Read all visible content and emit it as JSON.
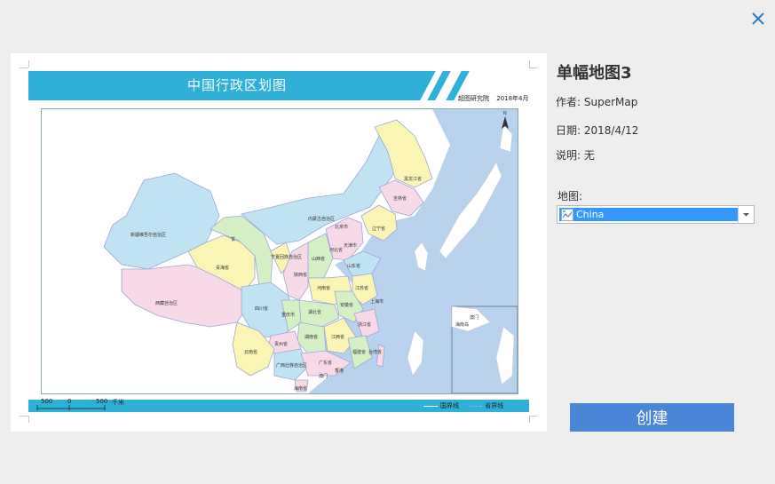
{
  "dialog": {
    "close_icon": "close-icon",
    "accent_color": "#2d7cc7"
  },
  "preview": {
    "banner_title": "中国行政区划图",
    "publisher": "超图研究院",
    "date": "2018年4月",
    "scale": {
      "left": "500",
      "zero": "0",
      "right": "500",
      "unit": "千米"
    },
    "legend": {
      "national_border": "国界线",
      "provincial_border": "省界线"
    },
    "colors": {
      "banner": "#2eb0d8",
      "sea": "#b8d2ee",
      "yellow": "#fbf5b5",
      "pink": "#f8d9e8",
      "blue": "#bfe3f2",
      "green": "#d6f0c5"
    },
    "regions": {
      "xinjiang": "新疆维吾尔自治区",
      "xizang": "西藏自治区",
      "qinghai": "青海省",
      "gansu": "甘",
      "neimenggu": "内蒙古自治区",
      "heilongjiang": "黑龙江省",
      "jilin": "吉林省",
      "liaoning": "辽宁省",
      "beijing": "北京市",
      "tianjin": "天津市",
      "hebei": "河北省",
      "shanxi": "山西省",
      "shandong": "山东省",
      "ningxia": "宁夏回族自治区",
      "shaanxi": "陕西省",
      "henan": "河南省",
      "jiangsu": "江苏省",
      "anhui": "安徽省",
      "shanghai": "上海市",
      "hubei": "湖北省",
      "sichuan": "四川省",
      "chongqing": "重庆市",
      "zhejiang": "浙江省",
      "hunan": "湖南省",
      "jiangxi": "江西省",
      "guizhou": "贵州省",
      "fujian": "福建省",
      "yunnan": "云南省",
      "guangxi": "广西壮族自治区",
      "guangdong": "广东省",
      "taiwan": "台湾省",
      "hainan": "海南省",
      "macau": "澳门",
      "hongkong": "香港",
      "inset_macau": "澳门",
      "inset_hainan": "海南岛"
    },
    "north_icon": "north-arrow-icon"
  },
  "details": {
    "title": "单幅地图3",
    "author_label": "作者: ",
    "author": "SuperMap",
    "date_label": "日期: ",
    "date": "2018/4/12",
    "desc_label": "说明: ",
    "desc": "无",
    "map_label": "地图:",
    "map_selected": "China",
    "map_icon": "map-icon"
  },
  "actions": {
    "create_label": "创建",
    "create_color": "#4a86d8"
  }
}
